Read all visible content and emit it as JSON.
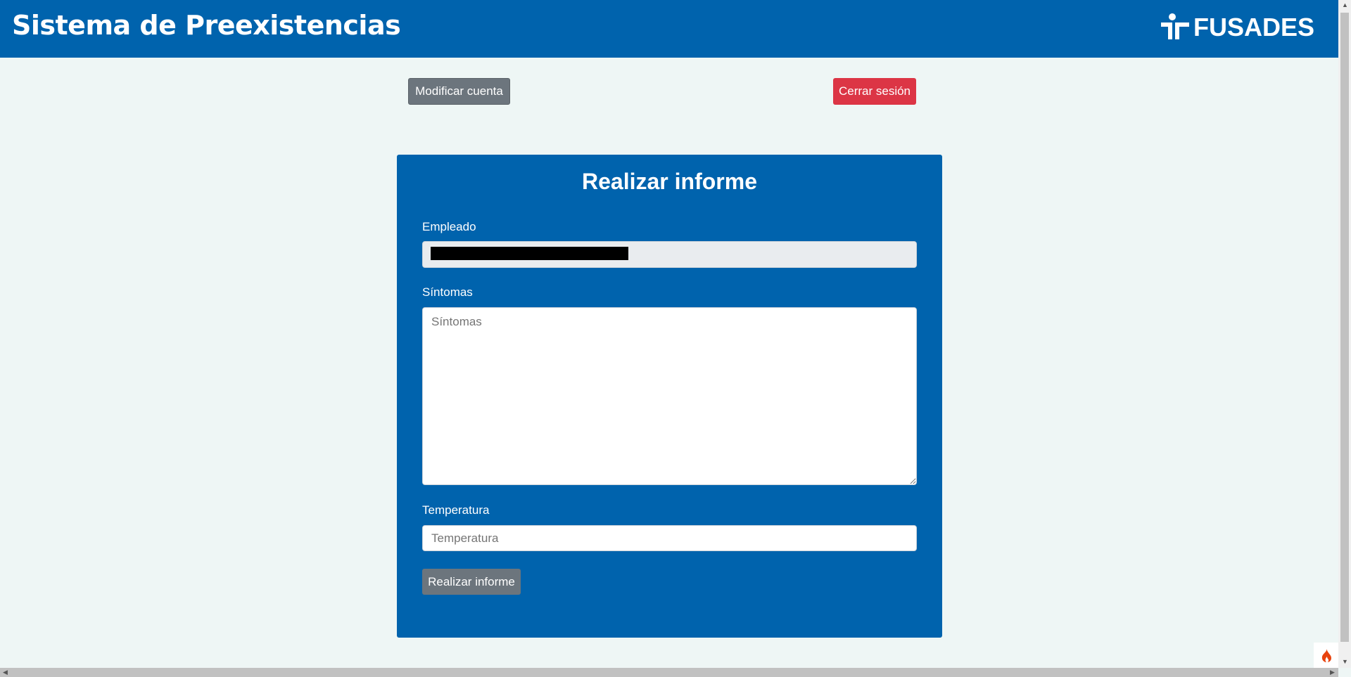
{
  "header": {
    "title": "Sistema de Preexistencias",
    "logo_text": "FUSADES"
  },
  "toolbar": {
    "modify_account": "Modificar cuenta",
    "logout": "Cerrar sesión"
  },
  "form": {
    "title": "Realizar informe",
    "employee_label": "Empleado",
    "symptoms_label": "Síntomas",
    "symptoms_placeholder": "Síntomas",
    "temperature_label": "Temperatura",
    "temperature_placeholder": "Temperatura",
    "submit": "Realizar informe"
  },
  "colors": {
    "primary": "#0063ad",
    "danger": "#dc3545",
    "secondary": "#6c757d"
  }
}
